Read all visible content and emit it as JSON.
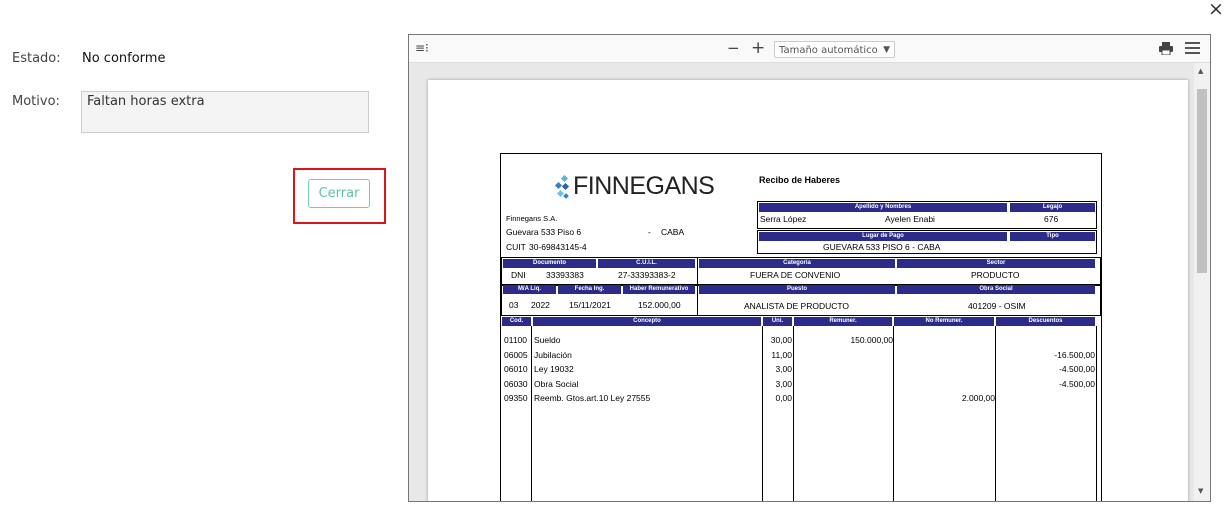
{
  "close_icon": "×",
  "estado": {
    "label": "Estado:",
    "value": "No conforme"
  },
  "motivo": {
    "label": "Motivo:",
    "value": "Faltan horas extra"
  },
  "cerrar_label": "Cerrar",
  "viewer": {
    "zoom_value": "Tamaño automático",
    "icons": [
      "sidebar-toggle-icon",
      "zoom-out-icon",
      "zoom-in-icon",
      "print-icon",
      "menu-icon"
    ]
  },
  "receipt": {
    "brand": "FINNEGANS",
    "title": "Recibo de Haberes",
    "company": "Finnegans S.A.",
    "address": "Guevara 533 Piso 6",
    "dash": "-",
    "city": "CABA",
    "cuit_label": "CUIT",
    "cuit": "30-69843145-4",
    "h_apellido": "Apellido y Nombres",
    "h_legajo": "Legajo",
    "apellido": "Serra López",
    "nombre": "Ayelen Enabi",
    "legajo": "676",
    "h_lugar": "Lugar de Pago",
    "h_tipo": "Tipo",
    "lugar": "GUEVARA 533 PISO 6 - CABA",
    "h_documento": "Documento",
    "h_cuil": "C.U.I.L.",
    "h_categoria": "Categoría",
    "h_sector": "Sector",
    "doc_tipo": "DNI",
    "doc_num": "33393383",
    "cuil": "27-33393383-2",
    "categoria": "FUERA DE CONVENIO",
    "sector": "PRODUCTO",
    "h_ma": "M/A Liq.",
    "h_fecha": "Fecha Ing.",
    "h_haber": "Haber Remunerativo",
    "h_puesto": "Puesto",
    "h_obra": "Obra Social",
    "mes": "03",
    "anio": "2022",
    "fecha": "15/11/2021",
    "haber": "152.000,00",
    "puesto": "ANALISTA DE PRODUCTO",
    "obra": "401209 - OSIM",
    "cols": [
      "Cod.",
      "Concepto",
      "Uni.",
      "Remuner.",
      "No Remuner.",
      "Descuentos"
    ],
    "rows": [
      {
        "cod": "01100",
        "concepto": "Sueldo",
        "uni": "30,00",
        "rem": "150.000,00",
        "norem": "",
        "desc": ""
      },
      {
        "cod": "06005",
        "concepto": "Jubilación",
        "uni": "11,00",
        "rem": "",
        "norem": "",
        "desc": "-16.500,00"
      },
      {
        "cod": "06010",
        "concepto": "Ley 19032",
        "uni": "3,00",
        "rem": "",
        "norem": "",
        "desc": "-4.500,00"
      },
      {
        "cod": "06030",
        "concepto": "Obra Social",
        "uni": "3,00",
        "rem": "",
        "norem": "",
        "desc": "-4.500,00"
      },
      {
        "cod": "09350",
        "concepto": "Reemb. Gtos.art.10 Ley 27555",
        "uni": "0,00",
        "rem": "",
        "norem": "2.000,00",
        "desc": ""
      }
    ]
  }
}
